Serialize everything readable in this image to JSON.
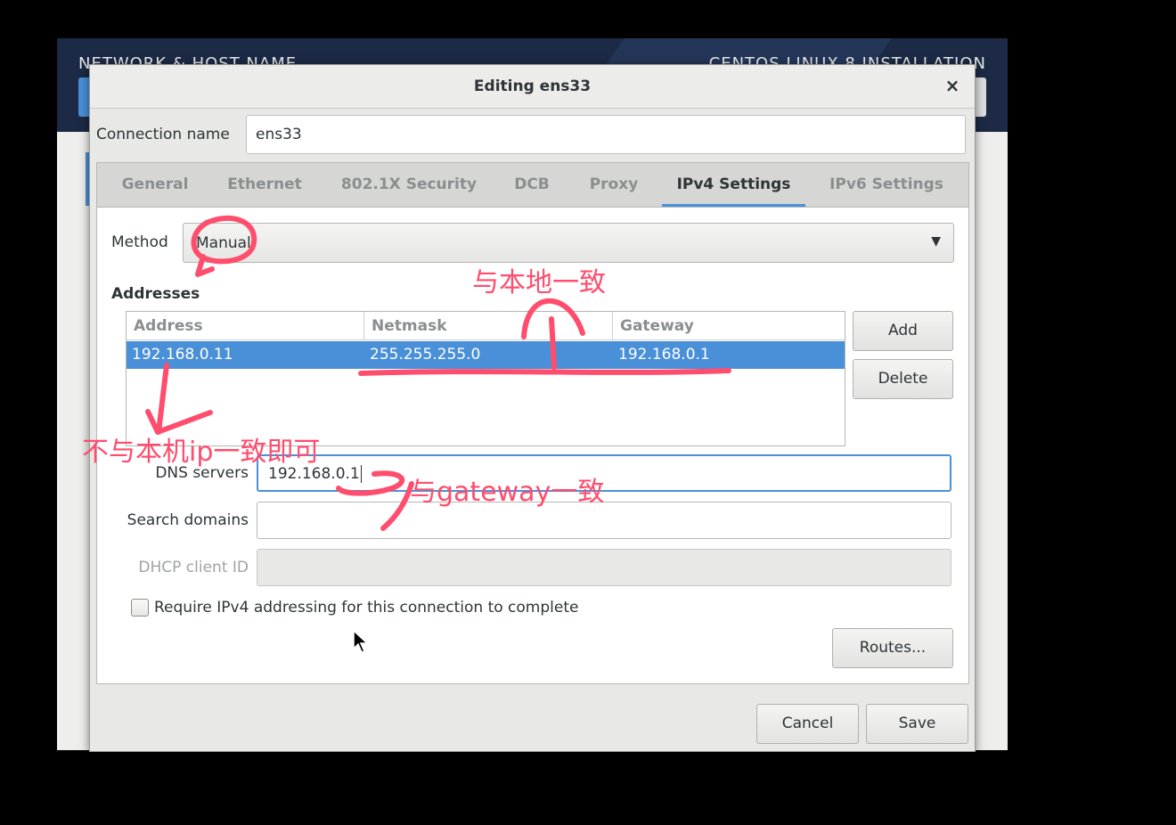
{
  "background": {
    "left_title": "NETWORK & HOST NAME",
    "right_title": "CENTOS LINUX 8 INSTALLATION"
  },
  "dialog": {
    "title": "Editing ens33",
    "close_symbol": "×",
    "connection_name_label": "Connection name",
    "connection_name_value": "ens33",
    "tabs": [
      {
        "label": "General",
        "active": false
      },
      {
        "label": "Ethernet",
        "active": false
      },
      {
        "label": "802.1X Security",
        "active": false
      },
      {
        "label": "DCB",
        "active": false
      },
      {
        "label": "Proxy",
        "active": false
      },
      {
        "label": "IPv4 Settings",
        "active": true
      },
      {
        "label": "IPv6 Settings",
        "active": false
      }
    ],
    "method_label": "Method",
    "method_value": "Manual",
    "addresses_heading": "Addresses",
    "addresses_table": {
      "headers": [
        "Address",
        "Netmask",
        "Gateway"
      ],
      "rows": [
        [
          "192.168.0.11",
          "255.255.255.0",
          "192.168.0.1"
        ]
      ]
    },
    "add_label": "Add",
    "delete_label": "Delete",
    "dns_label": "DNS servers",
    "dns_value": "192.168.0.1",
    "search_label": "Search domains",
    "search_value": "",
    "dhcp_label": "DHCP client ID",
    "dhcp_value": "",
    "require_label": "Require IPv4 addressing for this connection to complete",
    "require_checked": false,
    "routes_label": "Routes...",
    "cancel_label": "Cancel",
    "save_label": "Save"
  },
  "annotations": {
    "local": "与本地一致",
    "not_same": "不与本机ip一致即可",
    "gateway": "与gateway一致",
    "color": "#ff4d6d"
  },
  "colors": {
    "accent": "#4a90d9",
    "header_bg": "#1c2a45"
  }
}
